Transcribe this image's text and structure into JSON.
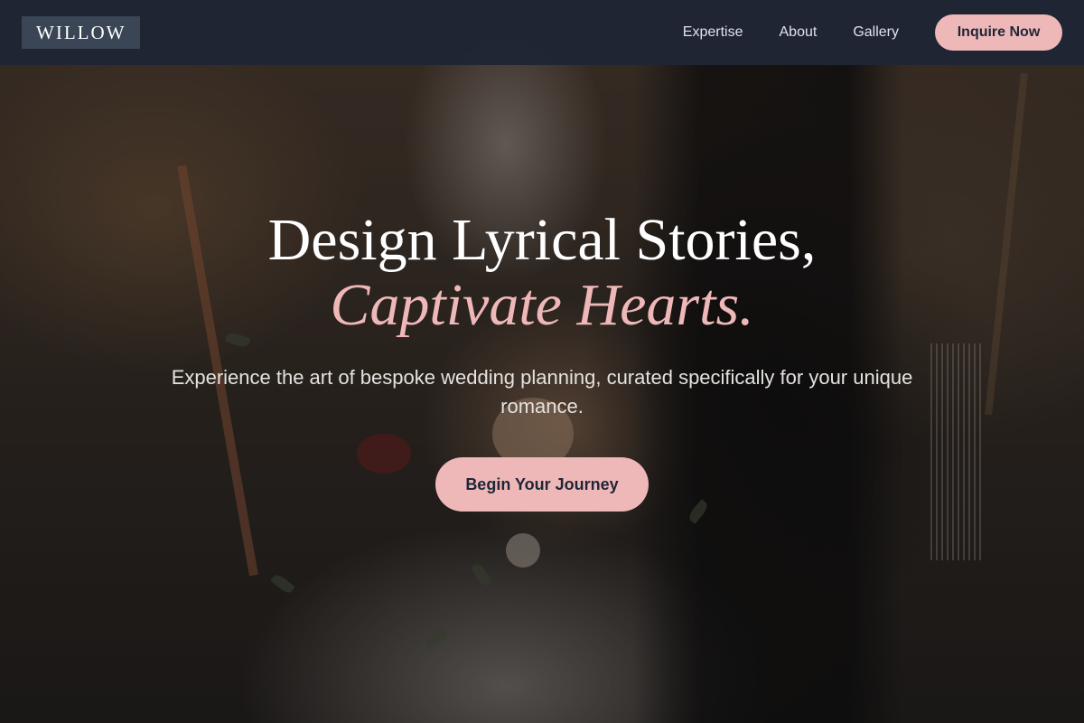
{
  "nav": {
    "logo": "WILLOW",
    "links": [
      "Expertise",
      "About",
      "Gallery"
    ],
    "cta_label": "Inquire Now"
  },
  "hero": {
    "headline_line1": "Design Lyrical Stories,",
    "headline_line2": "Captivate Hearts.",
    "subtitle": "Experience the art of bespoke wedding planning, curated specifically for your unique romance.",
    "cta_label": "Begin Your Journey"
  },
  "colors": {
    "accent_pink": "#efb8b8",
    "nav_bg": "#1e2534",
    "button_text": "#1f2637"
  }
}
